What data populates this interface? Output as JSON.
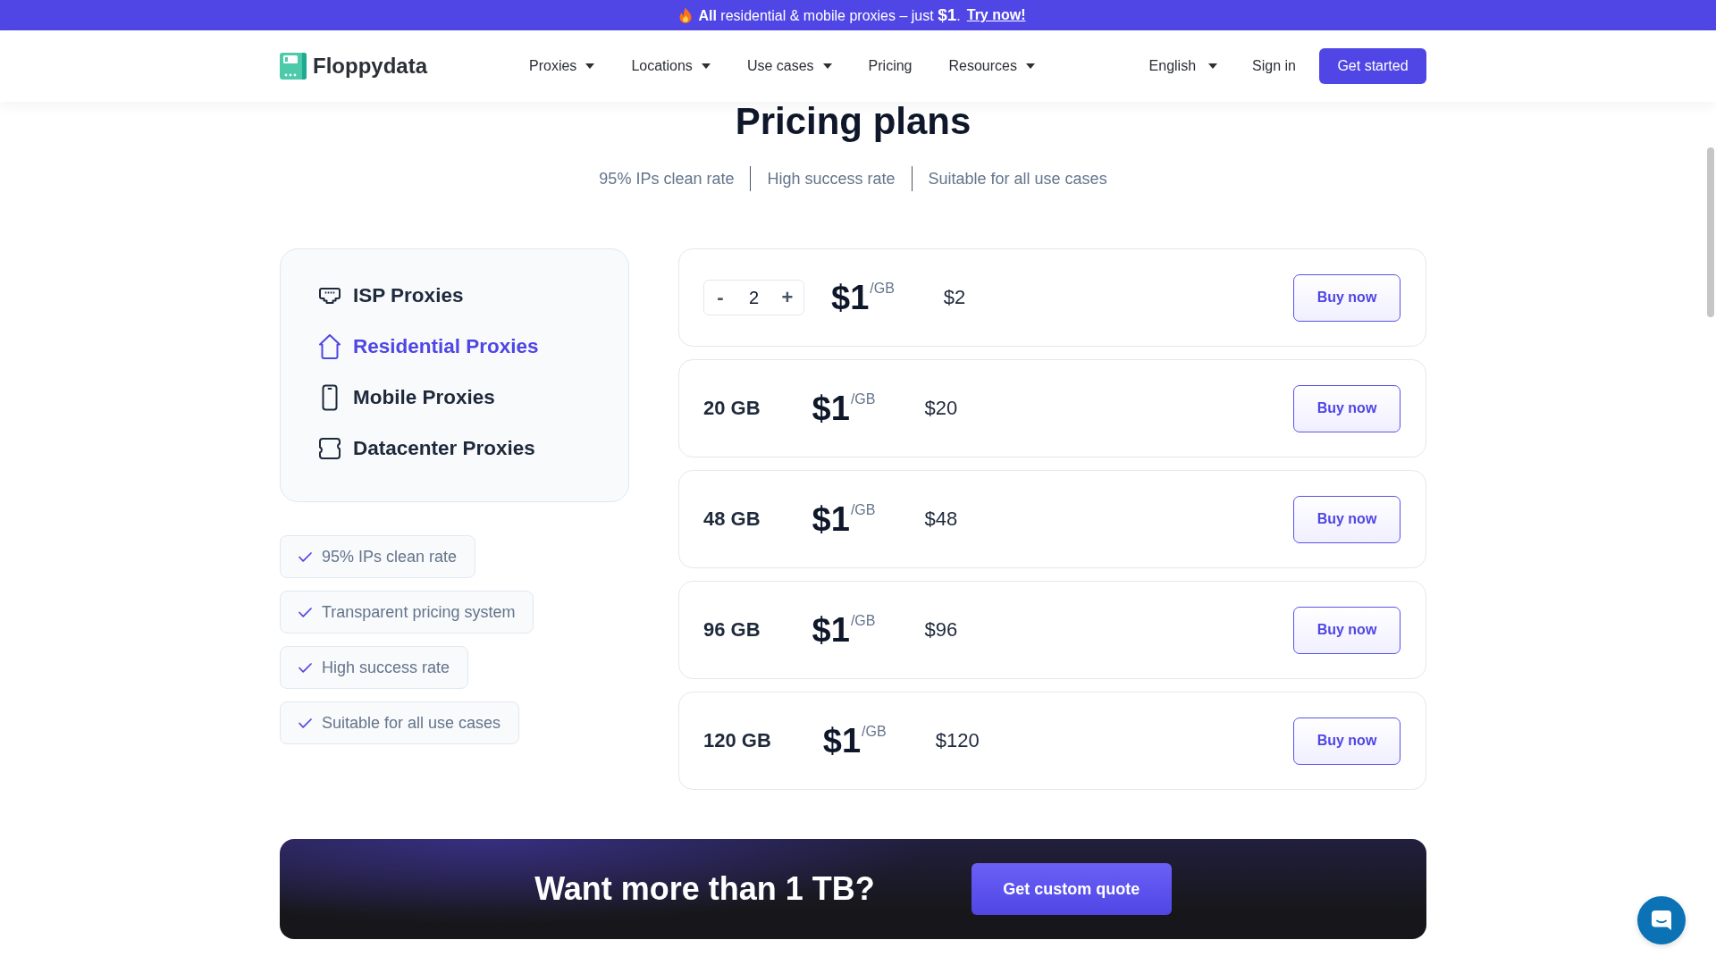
{
  "promo_banner": {
    "text": "**All** residential & mobile proxies – just **$1**.",
    "link": "Try now!"
  },
  "nav": {
    "logo": "Floppydata",
    "items": [
      {
        "label": "Proxies",
        "dropdown": true
      },
      {
        "label": "Locations",
        "dropdown": true
      },
      {
        "label": "Use cases",
        "dropdown": true
      },
      {
        "label": "Pricing",
        "dropdown": false
      },
      {
        "label": "Resources",
        "dropdown": true
      }
    ],
    "language": "English",
    "sign_in": "Sign in",
    "cta": "Get started"
  },
  "header": {
    "title": "Pricing plans",
    "highlights": [
      "95% IPs clean rate",
      "High success rate",
      "Suitable for all use cases"
    ]
  },
  "products": [
    {
      "kind": "isp",
      "label": "ISP Proxies",
      "selected": false
    },
    {
      "kind": "residential",
      "label": "Residential Proxies",
      "selected": true
    },
    {
      "kind": "mobile",
      "label": "Mobile Proxies",
      "selected": false
    },
    {
      "kind": "datacenter",
      "label": "Datacenter Proxies",
      "selected": false
    }
  ],
  "features": [
    "95% IPs clean rate",
    "Transparent pricing system",
    "High success rate",
    "Suitable for all use cases"
  ],
  "plans": [
    {
      "kind": "stepper",
      "minus": "-",
      "quantity": "2",
      "plus": "+",
      "price": "$1",
      "unit": "/GB",
      "total": "$2",
      "button": "Buy now"
    },
    {
      "kind": "fixed",
      "size": "20 GB",
      "price": "$1",
      "unit": "/GB",
      "total": "$20",
      "button": "Buy now"
    },
    {
      "kind": "fixed",
      "size": "48 GB",
      "price": "$1",
      "unit": "/GB",
      "total": "$48",
      "button": "Buy now"
    },
    {
      "kind": "fixed",
      "size": "96 GB",
      "price": "$1",
      "unit": "/GB",
      "total": "$96",
      "button": "Buy now"
    },
    {
      "kind": "fixed",
      "size": "120 GB",
      "price": "$1",
      "unit": "/GB",
      "total": "$120",
      "button": "Buy now"
    }
  ],
  "custom_quote": {
    "title": "Want more than 1 TB?",
    "button": "Get custom quote"
  }
}
